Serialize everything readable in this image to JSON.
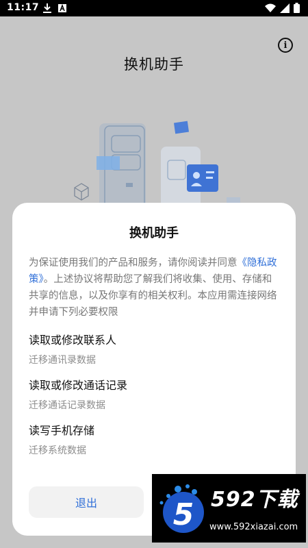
{
  "status_bar": {
    "time": "11:17",
    "left_icons": [
      "download-icon",
      "text-a-icon"
    ],
    "right_icons": [
      "wifi-icon",
      "signal-icon",
      "battery-icon"
    ]
  },
  "background": {
    "title": "换机助手",
    "info_icon": "info-icon",
    "info_glyph": "i"
  },
  "dialog": {
    "title": "换机助手",
    "body_before_link": "为保证使用我们的产品和服务，请你阅读并同意",
    "privacy_link": "《隐私政策》",
    "body_after_link": "。上述协议将帮助您了解我们将收集、使用、存储和共享的信息，以及你享有的相关权利。本应用需连接网络并申请下列必要权限",
    "permissions": [
      {
        "title": "读取或修改联系人",
        "desc": "迁移通讯录数据"
      },
      {
        "title": "读取或修改通话记录",
        "desc": "迁移通话记录数据"
      },
      {
        "title": "读写手机存储",
        "desc": "迁移系统数据"
      }
    ],
    "exit_label": "退出"
  },
  "watermark": {
    "brand": "592下载",
    "url": "www.592xiazai.com",
    "logo_digit": "5"
  },
  "colors": {
    "accent": "#2f6fd8",
    "scrim": "#c6c6c6",
    "dialog_bg": "#ffffff"
  }
}
